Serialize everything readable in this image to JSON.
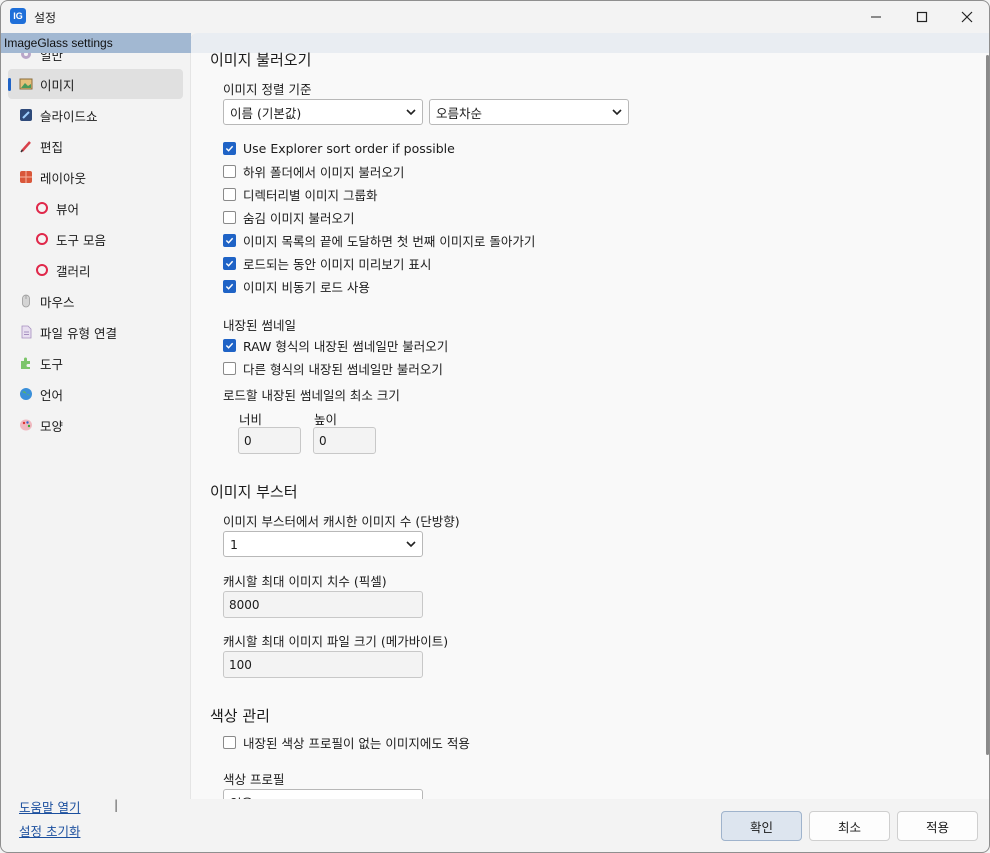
{
  "window": {
    "title": "설정",
    "app_icon_text": "IG",
    "tooltip": "ImageGlass settings"
  },
  "sidebar": {
    "items": [
      {
        "label": "일반",
        "icon": "gear-icon"
      },
      {
        "label": "이미지",
        "icon": "image-icon"
      },
      {
        "label": "슬라이드쇼",
        "icon": "slideshow-icon"
      },
      {
        "label": "편집",
        "icon": "pencil-icon"
      },
      {
        "label": "레이아웃",
        "icon": "layout-icon"
      },
      {
        "label": "뷰어",
        "icon": "ring-icon"
      },
      {
        "label": "도구 모음",
        "icon": "ring-icon"
      },
      {
        "label": "갤러리",
        "icon": "ring-icon"
      },
      {
        "label": "마우스",
        "icon": "mouse-icon"
      },
      {
        "label": "파일 유형 연결",
        "icon": "file-icon"
      },
      {
        "label": "도구",
        "icon": "puzzle-icon"
      },
      {
        "label": "언어",
        "icon": "globe-icon"
      },
      {
        "label": "모양",
        "icon": "palette-icon"
      }
    ],
    "links": {
      "help": "도움말 열기",
      "separator": "|",
      "reset": "설정 초기화"
    }
  },
  "content": {
    "load_section": {
      "title": "이미지 불러오기",
      "sort_label": "이미지 정렬 기준",
      "sort_by": "이름 (기본값)",
      "sort_order": "오름차순",
      "options": [
        {
          "label": "Use Explorer sort order if possible",
          "checked": true
        },
        {
          "label": "하위 폴더에서 이미지 불러오기",
          "checked": false
        },
        {
          "label": "디렉터리별 이미지 그룹화",
          "checked": false
        },
        {
          "label": "숨김 이미지 불러오기",
          "checked": false
        },
        {
          "label": "이미지 목록의 끝에 도달하면 첫 번째 이미지로 돌아가기",
          "checked": true
        },
        {
          "label": "로드되는 동안 이미지 미리보기 표시",
          "checked": true
        },
        {
          "label": "이미지 비동기 로드 사용",
          "checked": true
        }
      ]
    },
    "thumbnail_section": {
      "title": "내장된 썸네일",
      "options": [
        {
          "label": "RAW 형식의 내장된 썸네일만 불러오기",
          "checked": true
        },
        {
          "label": "다른 형식의 내장된 썸네일만 불러오기",
          "checked": false
        }
      ],
      "min_size_label": "로드할 내장된 썸네일의 최소 크기",
      "width_label": "너비",
      "height_label": "높이",
      "width_value": "0",
      "height_value": "0"
    },
    "booster_section": {
      "title": "이미지 부스터",
      "cache_count_label": "이미지 부스터에서 캐시한 이미지 수 (단방향)",
      "cache_count_value": "1",
      "max_dim_label": "캐시할 최대 이미지 치수 (픽셀)",
      "max_dim_value": "8000",
      "max_size_label": "캐시할 최대 이미지 파일 크기 (메가바이트)",
      "max_size_value": "100"
    },
    "color_section": {
      "title": "색상 관리",
      "apply_option": {
        "label": "내장된 색상 프로필이 없는 이미지에도 적용",
        "checked": false
      },
      "profile_label": "색상 프로필",
      "profile_value": "없음"
    }
  },
  "footer": {
    "ok": "확인",
    "cancel": "최소",
    "apply": "적용"
  },
  "colors": {
    "accent": "#1f63c6",
    "ring": "#e0284a",
    "tooltip_bg": "#a2b8d2"
  }
}
